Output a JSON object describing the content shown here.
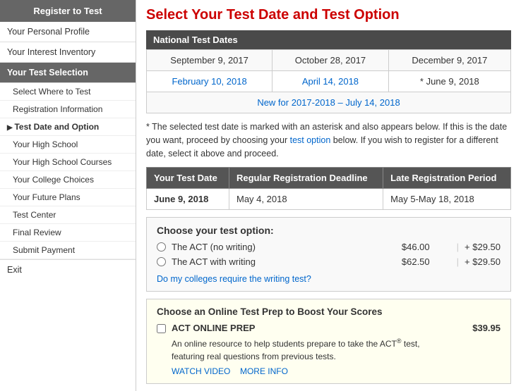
{
  "sidebar": {
    "header": "Register to Test",
    "items": [
      {
        "label": "Your Personal Profile",
        "active": false,
        "level": "top"
      },
      {
        "label": "Your Interest Inventory",
        "active": false,
        "level": "top"
      },
      {
        "label": "Your Test Selection",
        "active": true,
        "level": "top"
      },
      {
        "label": "Select Where to Test",
        "active": false,
        "level": "sub"
      },
      {
        "label": "Registration Information",
        "active": false,
        "level": "sub"
      },
      {
        "label": "Test Date and Option",
        "active": false,
        "level": "sub-arrow"
      },
      {
        "label": "Your High School",
        "active": false,
        "level": "sub"
      },
      {
        "label": "Your High School Courses",
        "active": false,
        "level": "sub"
      },
      {
        "label": "Your College Choices",
        "active": false,
        "level": "sub"
      },
      {
        "label": "Your Future Plans",
        "active": false,
        "level": "sub"
      },
      {
        "label": "Test Center",
        "active": false,
        "level": "sub"
      },
      {
        "label": "Final Review",
        "active": false,
        "level": "sub"
      },
      {
        "label": "Submit Payment",
        "active": false,
        "level": "sub"
      }
    ],
    "exit_label": "Exit"
  },
  "main": {
    "title": "Select Your Test Date and Test Option",
    "national_test_dates_header": "National Test Dates",
    "dates": [
      [
        "September 9, 2017",
        "October 28, 2017",
        "December 9, 2017"
      ],
      [
        "February 10, 2018",
        "April 14, 2018",
        "* June 9, 2018"
      ]
    ],
    "new_link_text": "New for 2017-2018 – July 14, 2018",
    "note": "* The selected test date is marked with an asterisk and also appears below. If this is the date you want, proceed by choosing your",
    "note_link": "test option",
    "note_after": "below. If you wish to register for a different date, select it above and proceed.",
    "test_date_table": {
      "headers": [
        "Your Test Date",
        "Regular Registration Deadline",
        "Late Registration Period"
      ],
      "row": [
        "June 9, 2018",
        "May 4, 2018",
        "May 5-May 18, 2018"
      ]
    },
    "test_option": {
      "title": "Choose your test option:",
      "options": [
        {
          "label": "The ACT (no writing)",
          "price": "$46.00",
          "extra": "+ $29.50"
        },
        {
          "label": "The ACT with writing",
          "price": "$62.50",
          "extra": "+ $29.50"
        }
      ],
      "colleges_link": "Do my colleges require the writing test?"
    },
    "online_prep": {
      "title": "Choose an Online Test Prep to Boost Your Scores",
      "name": "ACT ONLINE PREP",
      "price": "$39.95",
      "desc_line1": "An online resource to help students prepare to take the ACT",
      "reg_mark": "®",
      "desc_line2": "test,",
      "desc_line3": "featuring real questions from previous tests.",
      "watch_link": "WATCH VIDEO",
      "more_link": "MORE INFO"
    }
  }
}
